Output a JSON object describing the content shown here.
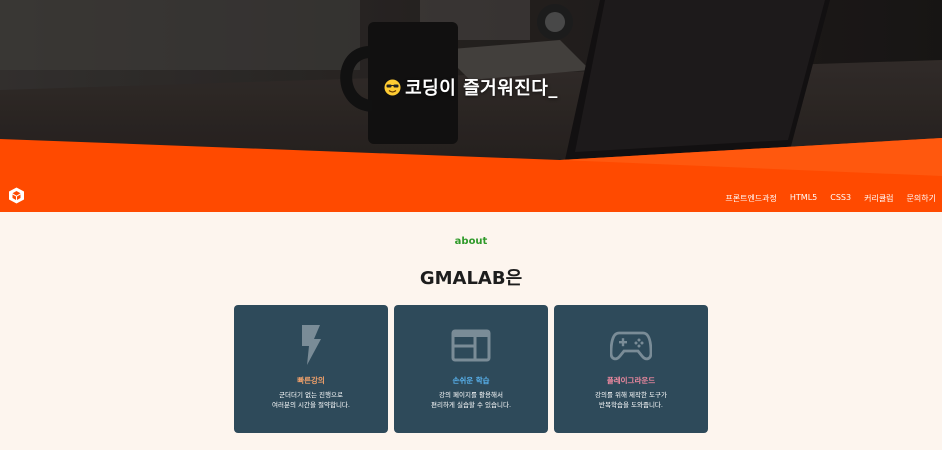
{
  "hero": {
    "title": "코딩이 즐거워진다_",
    "emoji_icon": "sunglasses-face-icon"
  },
  "brand": {
    "logo_icon": "unity-cube-logo-icon",
    "accent": "#ff4a00"
  },
  "nav": {
    "items": [
      "프론트엔드과정",
      "HTML5",
      "CSS3",
      "커리큘럼",
      "문의하기"
    ]
  },
  "about": {
    "eyebrow": "about",
    "title": "GMALAB은"
  },
  "cards": [
    {
      "icon": "lightning-bolt-icon",
      "title": "빠른강의",
      "title_color": "#f0a06a",
      "desc": "군더더기 없는 진행으로\n여러분의 시간을 절약합니다."
    },
    {
      "icon": "layout-window-icon",
      "title": "손쉬운 학습",
      "title_color": "#59b4f0",
      "desc": "강의 페이지를 활용해서\n편리하게 실습할 수 있습니다."
    },
    {
      "icon": "gamepad-icon",
      "title": "플레이그라운드",
      "title_color": "#f08aa0",
      "desc": "강의를 위해 제작한 도구가\n반복학습을 도와줍니다."
    }
  ]
}
